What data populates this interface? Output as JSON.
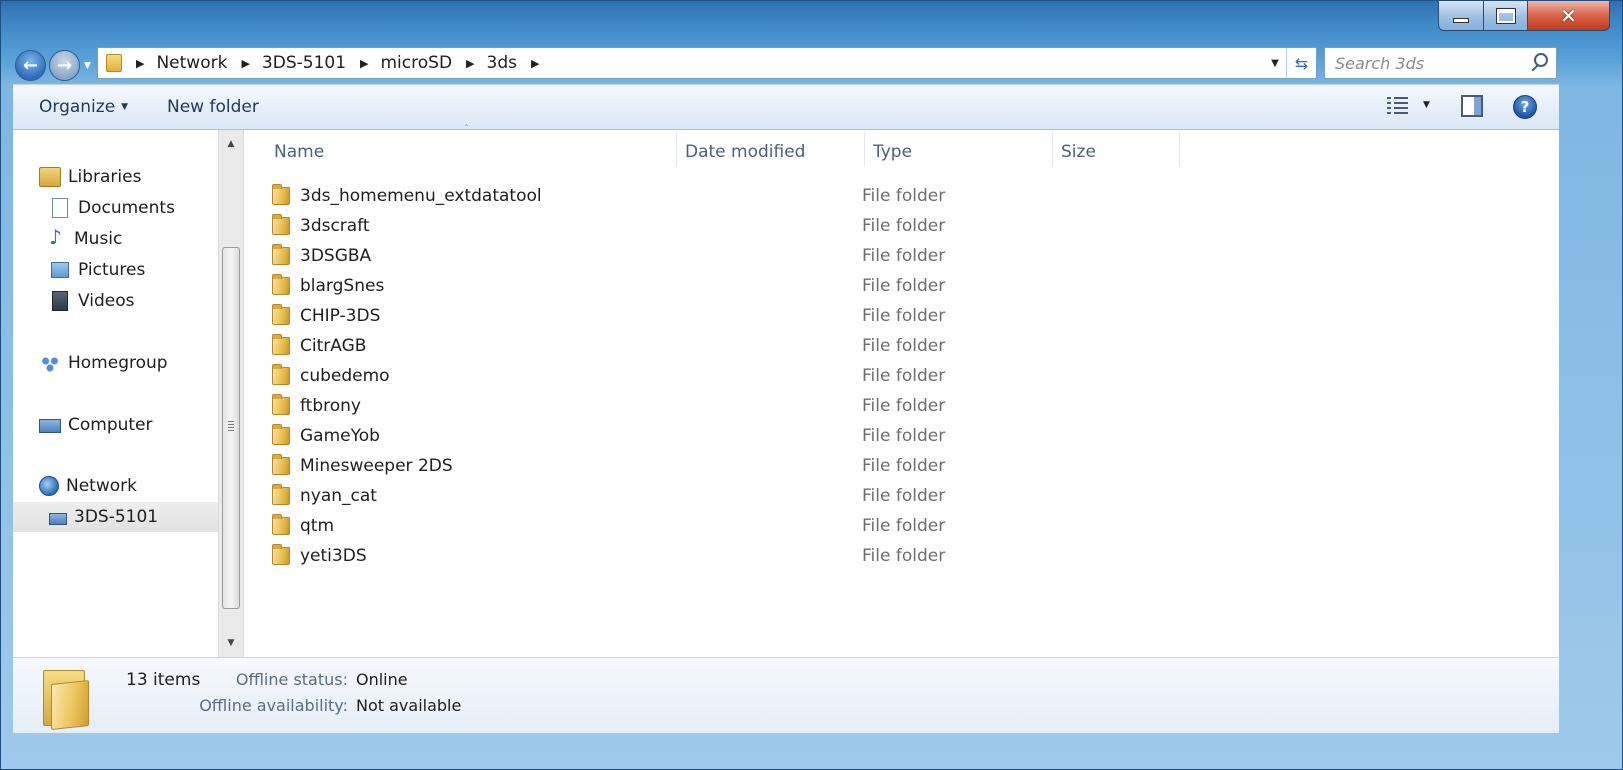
{
  "window": {
    "caption": {
      "minimize": "–",
      "maximize": "□",
      "close": "✕"
    }
  },
  "nav": {
    "back_glyph": "←",
    "forward_glyph": "→"
  },
  "address": {
    "segments": [
      "Network",
      "3DS-5101",
      "microSD",
      "3ds"
    ],
    "separator": "▶"
  },
  "search": {
    "placeholder": "Search 3ds"
  },
  "commandbar": {
    "organize_label": "Organize",
    "newfolder_label": "New folder",
    "help_glyph": "?"
  },
  "navpane": {
    "items": [
      {
        "label": "Libraries",
        "icon": "libraries-icon"
      },
      {
        "label": "Documents",
        "icon": "documents-icon"
      },
      {
        "label": "Music",
        "icon": "music-icon"
      },
      {
        "label": "Pictures",
        "icon": "pictures-icon"
      },
      {
        "label": "Videos",
        "icon": "videos-icon"
      },
      {
        "label": "Homegroup",
        "icon": "homegroup-icon"
      },
      {
        "label": "Computer",
        "icon": "computer-icon"
      },
      {
        "label": "Network",
        "icon": "network-icon"
      },
      {
        "label": "3DS-5101",
        "icon": "network-device-icon",
        "selected": true
      }
    ]
  },
  "columns": {
    "name": "Name",
    "date_modified": "Date modified",
    "type": "Type",
    "size": "Size"
  },
  "files": [
    {
      "name": "3ds_homemenu_extdatatool",
      "type": "File folder"
    },
    {
      "name": "3dscraft",
      "type": "File folder"
    },
    {
      "name": "3DSGBA",
      "type": "File folder"
    },
    {
      "name": "blargSnes",
      "type": "File folder"
    },
    {
      "name": "CHIP-3DS",
      "type": "File folder"
    },
    {
      "name": "CitrAGB",
      "type": "File folder"
    },
    {
      "name": "cubedemo",
      "type": "File folder"
    },
    {
      "name": "ftbrony",
      "type": "File folder"
    },
    {
      "name": "GameYob",
      "type": "File folder"
    },
    {
      "name": "Minesweeper 2DS",
      "type": "File folder"
    },
    {
      "name": "nyan_cat",
      "type": "File folder"
    },
    {
      "name": "qtm",
      "type": "File folder"
    },
    {
      "name": "yeti3DS",
      "type": "File folder"
    }
  ],
  "details": {
    "count": "13 items",
    "offline_status_label": "Offline status:",
    "offline_status_value": "Online",
    "offline_availability_label": "Offline availability:",
    "offline_availability_value": "Not available"
  }
}
